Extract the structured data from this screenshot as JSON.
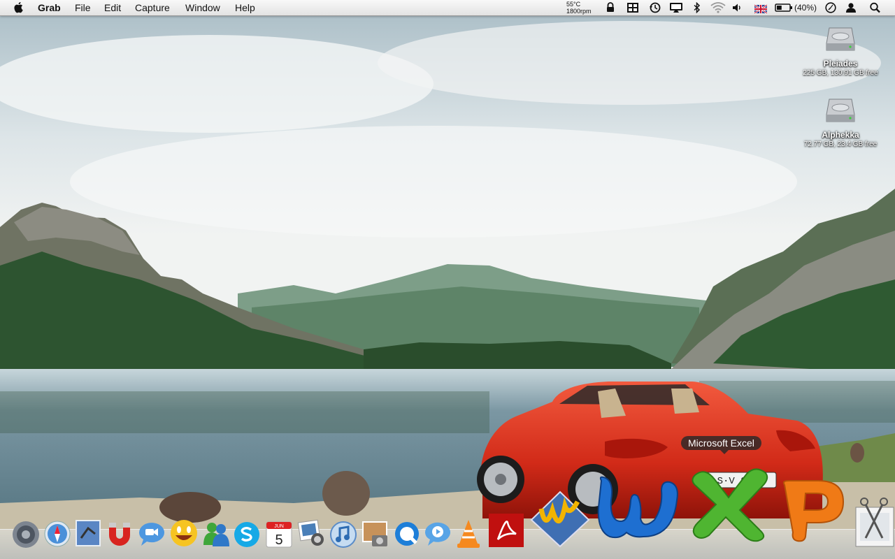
{
  "menubar": {
    "app_name": "Grab",
    "menus": [
      "File",
      "Edit",
      "Capture",
      "Window",
      "Help"
    ],
    "temperature": "55°C",
    "fan_speed": "1800rpm",
    "battery_percent": "(40%)",
    "battery_level": 0.4,
    "status_icons": [
      "lock-icon",
      "windows-icon",
      "time-machine-icon",
      "display-icon",
      "bluetooth-icon",
      "wifi-icon",
      "volume-icon",
      "uk-flag-icon",
      "battery-icon",
      "clock-icon",
      "user-icon",
      "spotlight-icon"
    ]
  },
  "desktop": {
    "drives": [
      {
        "name": "Pleiades",
        "info": "225 GB, 130.91 GB free"
      },
      {
        "name": "Alphekka",
        "info": "72.77 GB, 23.4 GB free"
      }
    ]
  },
  "dock": {
    "tooltip": "Microsoft Excel",
    "icons": [
      "system-preferences-icon",
      "safari-icon",
      "mail-icon",
      "magnet-icon",
      "ichat-icon",
      "adium-icon",
      "messenger-icon",
      "skype-icon",
      "ical-icon",
      "iphoto-icon",
      "itunes-icon",
      "image-capture-icon",
      "quicktime-icon",
      "remote-icon",
      "vlc-icon",
      "acrobat-icon",
      "textwrangler-icon",
      "word-icon",
      "excel-icon",
      "powerpoint-icon",
      "grab-icon"
    ],
    "ical_day": "5",
    "ical_month": "JUN"
  },
  "colors": {
    "sky": "#e6ecef",
    "water": "#6f8f9e",
    "forest": "#2f5a32",
    "car_red": "#d8301f",
    "word_blue": "#1e6fd1",
    "excel_green": "#4fb531",
    "ppt_orange": "#f07a16"
  }
}
